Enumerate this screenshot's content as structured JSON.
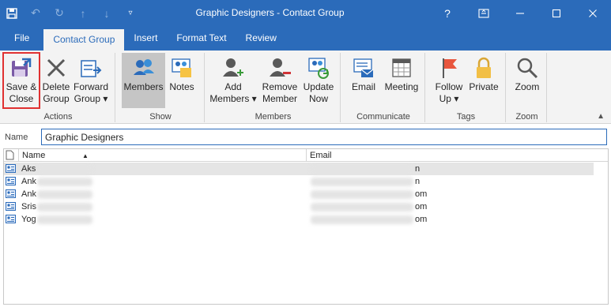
{
  "window": {
    "title": "Graphic Designers  -  Contact Group",
    "help": "?",
    "restore": "▣",
    "minimize": "—",
    "maximize": "☐",
    "close": "✕"
  },
  "tabs": [
    {
      "label": "File"
    },
    {
      "label": "Contact Group"
    },
    {
      "label": "Insert"
    },
    {
      "label": "Format Text"
    },
    {
      "label": "Review"
    }
  ],
  "ribbon": {
    "groups": {
      "actions": "Actions",
      "show": "Show",
      "members": "Members",
      "communicate": "Communicate",
      "tags": "Tags",
      "zoom": "Zoom"
    },
    "buttons": {
      "save_close": [
        "Save &",
        "Close"
      ],
      "delete_group": [
        "Delete",
        "Group"
      ],
      "forward_group": [
        "Forward",
        "Group ▾"
      ],
      "members": [
        "Members"
      ],
      "notes": [
        "Notes"
      ],
      "add_members": [
        "Add",
        "Members ▾"
      ],
      "remove_member": [
        "Remove",
        "Member"
      ],
      "update_now": [
        "Update",
        "Now"
      ],
      "email": [
        "Email"
      ],
      "meeting": [
        "Meeting"
      ],
      "follow_up": [
        "Follow",
        "Up ▾"
      ],
      "private": [
        "Private"
      ],
      "zoom": [
        "Zoom"
      ]
    }
  },
  "name_field": {
    "label": "Name",
    "value": "Graphic Designers"
  },
  "list": {
    "columns": {
      "name": "Name",
      "email": "Email"
    },
    "rows": [
      {
        "name": "Aks",
        "email": "n",
        "selected": true
      },
      {
        "name": "Ank",
        "email": "n",
        "selected": false
      },
      {
        "name": "Ank",
        "email": "om",
        "selected": false
      },
      {
        "name": "Sris",
        "email": "om",
        "selected": false
      },
      {
        "name": "Yog",
        "email": "om",
        "selected": false
      }
    ]
  },
  "colors": {
    "accent": "#2b6bba",
    "ribbon_bg": "#f3f3f3",
    "highlight_outline": "#e03131"
  }
}
